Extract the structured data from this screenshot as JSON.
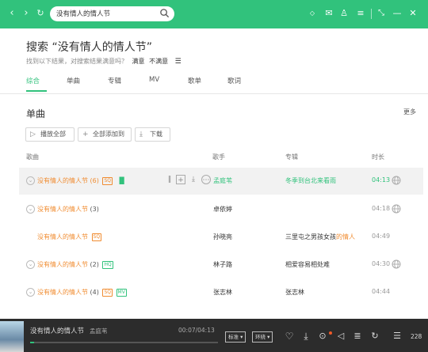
{
  "search": {
    "query": "没有情人的情人节"
  },
  "heading": {
    "title": "搜索 “没有情人的情人节”",
    "subtitle": "找到以下结果，对搜索结果满意吗？",
    "satisfied": "满意",
    "unsatisfied": "不满意"
  },
  "tabs": [
    "综合",
    "单曲",
    "专辑",
    "MV",
    "歌单",
    "歌词"
  ],
  "section": {
    "title": "单曲",
    "more": "更多"
  },
  "buttons": {
    "play_all": "播放全部",
    "add_all": "全部添加到",
    "download": "下载"
  },
  "columns": {
    "song": "歌曲",
    "singer": "歌手",
    "album": "专辑",
    "duration": "时长"
  },
  "rows": [
    {
      "name": "没有情人的情人节",
      "suffix": "(6)",
      "badges": [
        "SQ"
      ],
      "singer": "孟庭苇",
      "album": "冬季到台北来看雨",
      "duration": "04:13",
      "highlight": true
    },
    {
      "name": "没有情人的情人节",
      "suffix": "(3)",
      "badges": [],
      "singer": "卓依婷",
      "album": "",
      "duration": "04:18",
      "highlight": false
    },
    {
      "name": "没有情人的情人节",
      "suffix": "",
      "badges": [
        "SQ"
      ],
      "singer": "孙晓亮",
      "album": "三里屯之男孩女孩",
      "album_hl": "的情人",
      "duration": "04:49",
      "highlight": false
    },
    {
      "name": "没有情人的情人节",
      "suffix": "(2)",
      "badges": [
        "HQ"
      ],
      "singer": "林子路",
      "album": "相爱容易相处难",
      "duration": "04:30",
      "highlight": false
    },
    {
      "name": "没有情人的情人节",
      "suffix": "(4)",
      "badges": [
        "SQ",
        "MV"
      ],
      "singer": "张志林",
      "album": "张志林",
      "duration": "04:44",
      "highlight": false
    }
  ],
  "player": {
    "title": "没有情人的情人节",
    "singer": "孟庭苇",
    "time": "00:07/04:13",
    "progress_fraction": 0.02,
    "quality": "标准",
    "effect": "环绕",
    "count": "228"
  },
  "colors": {
    "brand": "#31c27c",
    "accent": "#f08c31",
    "player_bg": "#2c2c2c"
  }
}
